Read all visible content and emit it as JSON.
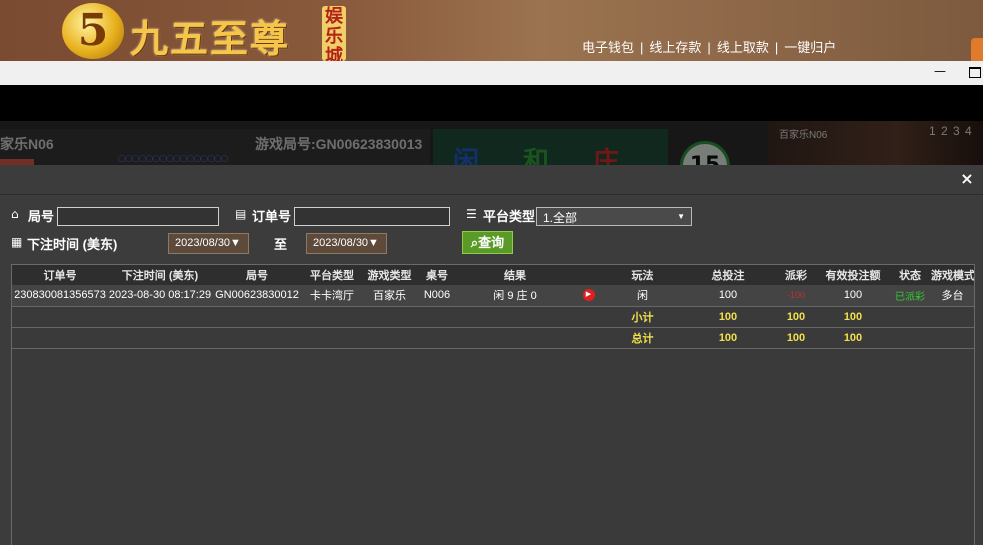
{
  "brand": {
    "logo_char": "5",
    "name": "九五至尊",
    "tag": "娱乐城"
  },
  "top_links": [
    "电子钱包",
    "线上存款",
    "线上取款",
    "一键归户"
  ],
  "top_links_sep": "|",
  "window": {
    "minimize": "—"
  },
  "game_strip": {
    "table_name": "家乐N06",
    "round_label": "游戏局号:GN00623830013",
    "beads": "○○○○○○○○○○○○○○○○",
    "bet_areas": [
      {
        "text": "闲",
        "color": "#2456c8"
      },
      {
        "text": "和",
        "color": "#2e9a3a"
      },
      {
        "text": "庄",
        "color": "#d02828"
      }
    ],
    "countdown": "15",
    "video_title": "百家乐N06",
    "video_numbers": "1 2 3 4"
  },
  "dialog": {
    "close": "×",
    "filters": {
      "round_label": "局号",
      "round_value": "",
      "order_label": "订单号",
      "order_value": "",
      "platform_label": "平台类型",
      "platform_selected": "1.全部",
      "time_label": "下注时间 (美东)",
      "date_from": "2023/08/30▼",
      "date_to_label": "至",
      "date_to": "2023/08/30▼",
      "query_label": "查询"
    },
    "table": {
      "headers": [
        "订单号",
        "下注时间 (美东)",
        "局号",
        "平台类型",
        "游戏类型",
        "桌号",
        "结果",
        "",
        "玩法",
        "总投注",
        "派彩",
        "有效投注额",
        "状态",
        "游戏模式"
      ],
      "rows": [
        [
          "230830081356573",
          "2023-08-30 08:17:29",
          "GN00623830012",
          "卡卡湾厅",
          "百家乐",
          "N006",
          "闲 9 庄 0",
          "",
          "闲",
          "100",
          "-100",
          "100",
          "已派彩",
          "多台"
        ]
      ],
      "subtotal": {
        "label": "小计",
        "total_bet": "100",
        "payout": "100",
        "valid_bet": "100"
      },
      "total": {
        "label": "总计",
        "total_bet": "100",
        "payout": "100",
        "valid_bet": "100"
      }
    }
  }
}
